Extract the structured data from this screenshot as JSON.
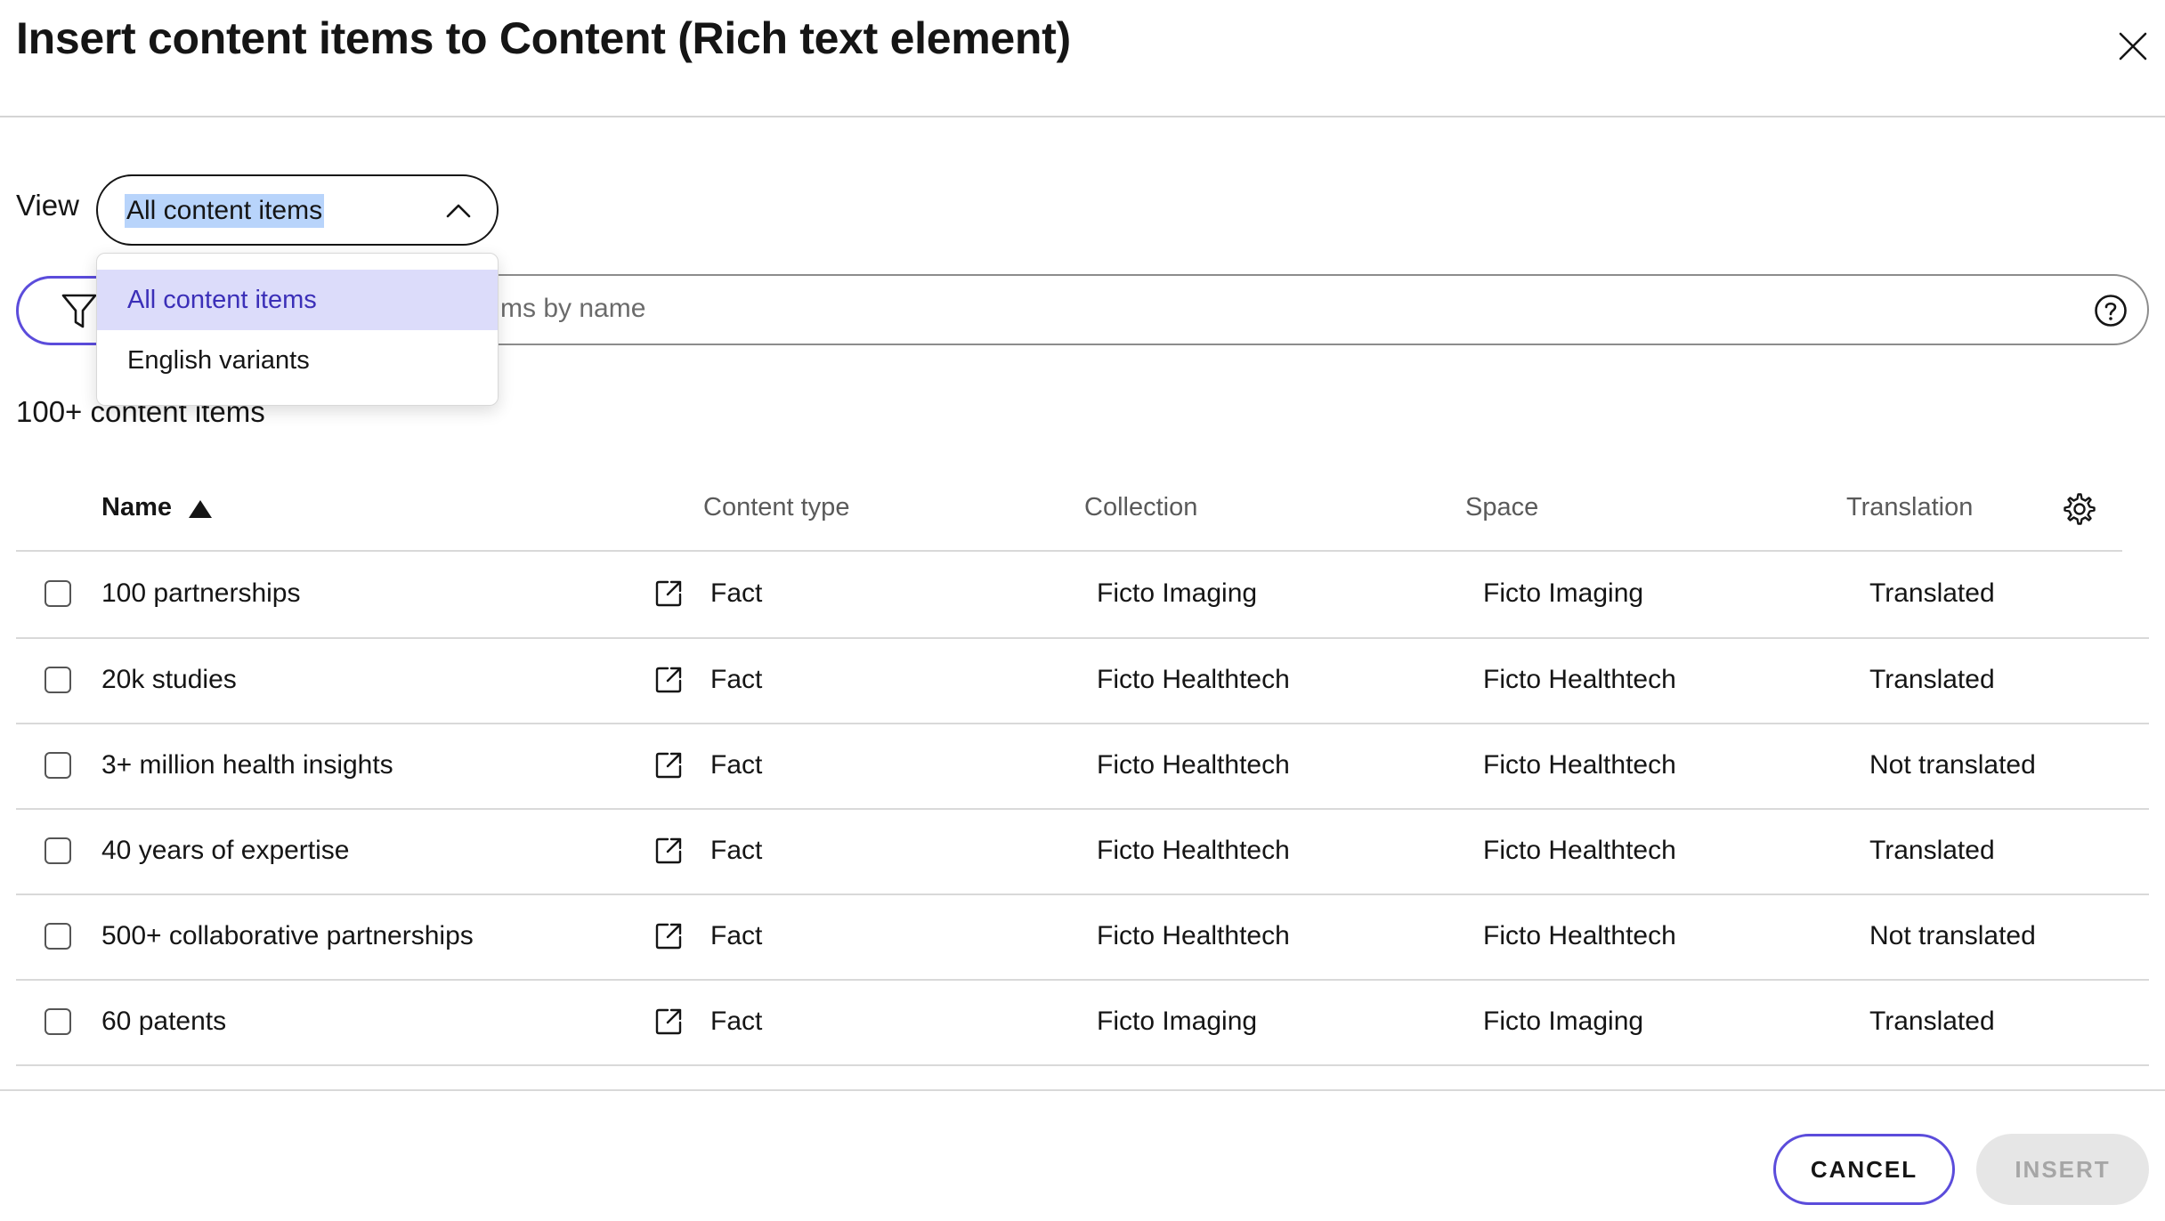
{
  "dialog": {
    "title": "Insert content items to Content (Rich text element)"
  },
  "view": {
    "label": "View",
    "selected": "All content items",
    "options": [
      "All content items",
      "English variants"
    ]
  },
  "search": {
    "placeholder_visible": "ms by name"
  },
  "results": {
    "count": "100+ content items"
  },
  "table": {
    "headers": {
      "name": "Name",
      "content_type": "Content type",
      "collection": "Collection",
      "space": "Space",
      "translation": "Translation"
    },
    "rows": [
      {
        "name": "100 partnerships",
        "type": "Fact",
        "collection": "Ficto Imaging",
        "space": "Ficto Imaging",
        "translation": "Translated"
      },
      {
        "name": "20k studies",
        "type": "Fact",
        "collection": "Ficto Healthtech",
        "space": "Ficto Healthtech",
        "translation": "Translated"
      },
      {
        "name": "3+ million health insights",
        "type": "Fact",
        "collection": "Ficto Healthtech",
        "space": "Ficto Healthtech",
        "translation": "Not translated"
      },
      {
        "name": "40 years of expertise",
        "type": "Fact",
        "collection": "Ficto Healthtech",
        "space": "Ficto Healthtech",
        "translation": "Translated"
      },
      {
        "name": "500+ collaborative partnerships",
        "type": "Fact",
        "collection": "Ficto Healthtech",
        "space": "Ficto Healthtech",
        "translation": "Not translated"
      },
      {
        "name": "60 patents",
        "type": "Fact",
        "collection": "Ficto Imaging",
        "space": "Ficto Imaging",
        "translation": "Translated"
      }
    ]
  },
  "footer": {
    "cancel_label": "CANCEL",
    "insert_label": "INSERT"
  },
  "colors": {
    "accent": "#5b4cdb",
    "selected_option_bg": "#dcdcfa",
    "selection_highlight": "#b8d4fb",
    "disabled_button_bg": "#e6e6e6"
  },
  "icons": [
    "close-icon",
    "chevron-up-icon",
    "filter-icon",
    "help-icon",
    "sort-ascending-icon",
    "gear-icon",
    "external-link-icon"
  ]
}
